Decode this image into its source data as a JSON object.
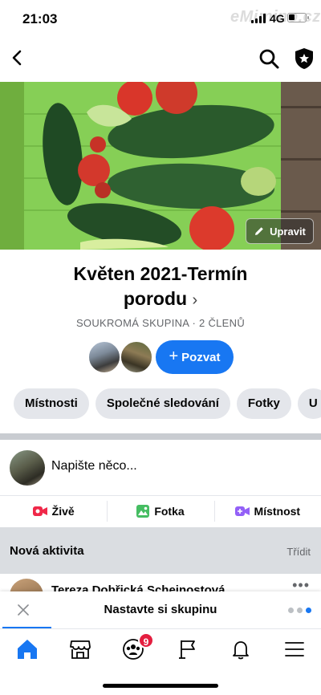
{
  "status_bar": {
    "time": "21:03",
    "network": "4G",
    "watermark": "eMimino.cz"
  },
  "nav": {
    "back_icon": "chevron-left-icon",
    "search_icon": "search-icon",
    "admin_icon": "shield-star-icon"
  },
  "cover": {
    "edit_label": "Upravit",
    "edit_icon": "pencil-icon"
  },
  "group": {
    "title_line1": "Květen 2021-Termín",
    "title_line2": "porodu",
    "title_chevron": "›",
    "subtitle": "SOUKROMÁ SKUPINA · 2 ČLENŮ",
    "invite_label": "Pozvat",
    "invite_plus": "+"
  },
  "chips": [
    "Místnosti",
    "Společné sledování",
    "Fotky",
    "U"
  ],
  "composer": {
    "placeholder": "Napište něco..."
  },
  "actions": [
    {
      "label": "Živě",
      "icon": "live-video-icon",
      "color": "#f02849"
    },
    {
      "label": "Fotka",
      "icon": "photo-icon",
      "color": "#45bd62"
    },
    {
      "label": "Místnost",
      "icon": "room-video-icon",
      "color": "#9360f7"
    }
  ],
  "activity": {
    "label": "Nová aktivita",
    "sort": "Třídit"
  },
  "post_preview": {
    "author": "Tereza Dobřická Scheinostová",
    "more": "•••"
  },
  "setup_bar": {
    "text": "Nastavte si skupinu"
  },
  "bottom_tabs": {
    "items": [
      "home-icon",
      "marketplace-icon",
      "groups-icon",
      "pages-flag-icon",
      "bell-icon",
      "menu-icon"
    ],
    "badge": "9",
    "active_color": "#1877f2"
  },
  "colors": {
    "accent": "#1877f2",
    "chip_bg": "#e4e6eb",
    "muted": "#65676b"
  }
}
